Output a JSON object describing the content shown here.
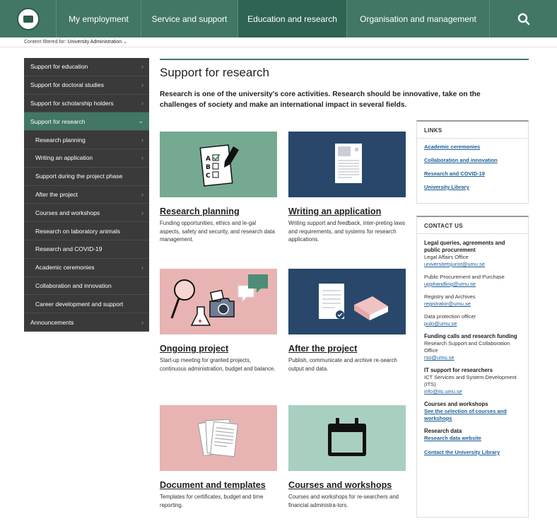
{
  "nav": {
    "items": [
      "My employment",
      "Service and support",
      "Education and research",
      "Organisation and management"
    ]
  },
  "filter": {
    "label": "Content filtered for:",
    "value": "University Administration"
  },
  "sidebar": {
    "items": [
      {
        "label": "Support for education"
      },
      {
        "label": "Support for doctoral studies"
      },
      {
        "label": "Support for scholarship holders"
      },
      {
        "label": "Support for research"
      },
      {
        "label": "Research planning"
      },
      {
        "label": "Writing an application"
      },
      {
        "label": "Support during the project phase"
      },
      {
        "label": "After the project"
      },
      {
        "label": "Courses and workshops"
      },
      {
        "label": "Research on laboratory animals"
      },
      {
        "label": "Research and COVID-19"
      },
      {
        "label": "Academic ceremonies"
      },
      {
        "label": "Collaboration and innovation"
      },
      {
        "label": "Career development and support"
      },
      {
        "label": "Announcements"
      }
    ]
  },
  "main": {
    "title": "Support for research",
    "intro": "Research is one of the university's core activities. Research should be innovative, take on the challenges of society and make an international impact in several fields.",
    "cards": [
      {
        "title": "Research planning",
        "text": "Funding opportunities, ethics and le-gal aspects, safety and security, and research data management."
      },
      {
        "title": "Writing an application",
        "text": "Writing support and feedback, inter-preting laws and requirements, and systems for research applications."
      },
      {
        "title": "Ongoing project",
        "text": "Start-up meeting for granted projects, continuous administration, budget and balance."
      },
      {
        "title": "After the project",
        "text": "Publish, communicate and archive re-search output and data."
      },
      {
        "title": "Document and templates",
        "text": "Templates for certificates, budget and time reporting."
      },
      {
        "title": "Courses and workshops",
        "text": "Courses and workshops for re-searchers and financial administra-tors."
      }
    ]
  },
  "links": {
    "heading": "LINKS",
    "items": [
      "Academic ceremonies",
      "Collaboration and innovation",
      "Research and COVID-19",
      "University Library"
    ]
  },
  "contact": {
    "heading": "CONTACT US",
    "legal_title": "Legal queries, agreements and public procurement",
    "legal_office": "Legal Affairs Office",
    "legal_email": "universitetsjurist@umu.se",
    "proc_office": "Public Procurement and Purchase",
    "proc_email": "upphandling@umu.se",
    "reg_office": "Registry and Archives",
    "reg_email": "registrator@umu.se",
    "dpo_office": "Data protection officer",
    "dpo_email": "pulo@umu.se",
    "funding_title": "Funding calls and research funding",
    "funding_office": "Research Support and Collaboration Office",
    "funding_email": "rso@umu.se",
    "it_title": "IT support for researchers",
    "it_office": "ICT Services and System Development (ITS)",
    "it_email": "info@its.umu.se",
    "courses_title": "Courses and workshops",
    "courses_link": "See the selection of courses and workshops",
    "data_title": "Research data",
    "data_link": "Research data website",
    "library_link": "Contact the University Library"
  },
  "colors": {
    "brand_green": "#417764",
    "active_nav": "#2f6353",
    "sidebar_bg": "#3a3a3a",
    "card_green": "#76a992",
    "card_navy": "#28476a",
    "card_pink": "#e8b4b3",
    "card_mint": "#a9cfc0",
    "link_blue": "#1a5e9a"
  }
}
